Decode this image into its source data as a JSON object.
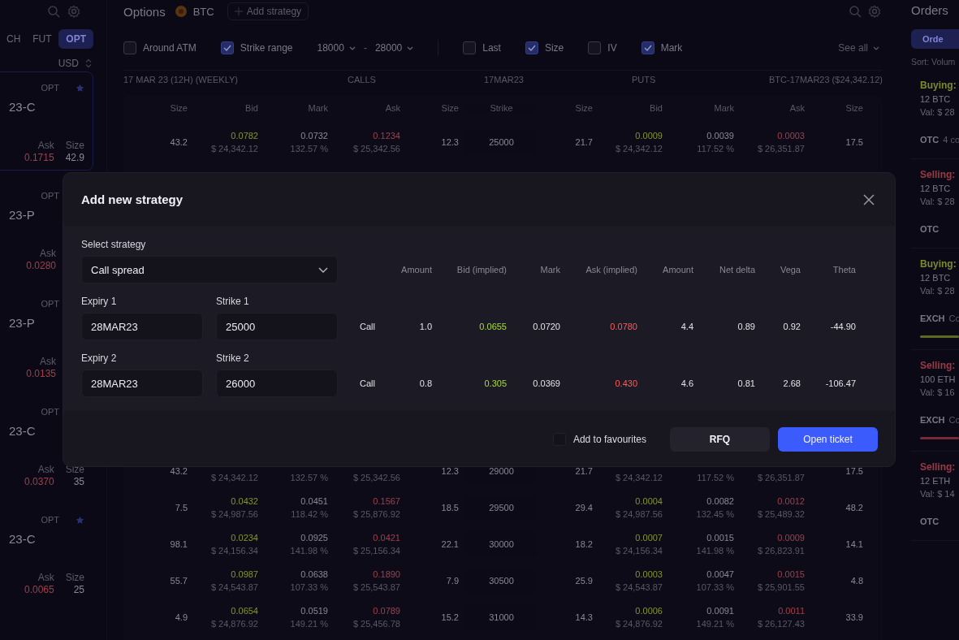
{
  "left_panel": {
    "market_tabs": [
      {
        "label": "CH",
        "selected": false
      },
      {
        "label": "FUT",
        "selected": false
      },
      {
        "label": "OPT",
        "selected": true
      }
    ],
    "currency": "USD",
    "instruments": [
      {
        "tag": "OPT",
        "starred": true,
        "selected": true,
        "name": "23-C",
        "ask_label": "Ask",
        "ask": "0.1715",
        "size_label": "Size",
        "size": "42.9"
      },
      {
        "tag": "OPT",
        "selected": false,
        "name": "23-P",
        "ask_label": "Ask",
        "ask": "0.0280"
      },
      {
        "tag": "OPT",
        "selected": false,
        "name": "23-P",
        "ask_label": "Ask",
        "ask": "0.0135"
      },
      {
        "tag": "OPT",
        "selected": false,
        "name": "23-C",
        "ask_label": "Ask",
        "ask": "0.0370",
        "size_label": "Size",
        "size": "35"
      },
      {
        "tag": "OPT",
        "starred": true,
        "selected": false,
        "name": "23-C",
        "ask_label": "Ask",
        "ask": "0.0065",
        "size_label": "Size",
        "size": "25"
      }
    ]
  },
  "main": {
    "title": "Options",
    "asset": "BTC",
    "add_strategy": "Add strategy",
    "filters": [
      {
        "label": "Around ATM",
        "checked": false
      },
      {
        "label": "Strike range",
        "checked": true
      }
    ],
    "range": {
      "from": "18000",
      "separator": "-",
      "to": "28000"
    },
    "column_toggles": [
      {
        "label": "Last",
        "checked": false
      },
      {
        "label": "Size",
        "checked": true
      },
      {
        "label": "IV",
        "checked": false
      },
      {
        "label": "Mark",
        "checked": true
      }
    ],
    "see_all": "See all",
    "section_labels": [
      "17 MAR 23 (12H) (WEEKLY)",
      "CALLS",
      "17MAR23",
      "PUTS",
      "BTC-17MAR23 ($24,342.12)"
    ],
    "columns": [
      "Size",
      "Bid",
      "Mark",
      "Ask",
      "Size",
      "Strike",
      "Size",
      "Bid",
      "Mark",
      "Ask",
      "Size"
    ],
    "rows": [
      {
        "cells": [
          "43.2",
          {
            "value": "0.0782",
            "sub": "$ 24,342.12"
          },
          {
            "value": "0.0732",
            "sub": "132.57 %"
          },
          {
            "value": "0.1234",
            "sub": "$ 25,342.56"
          },
          "12.3",
          "25000",
          "21.7",
          {
            "value": "0.0009",
            "sub": "$ 24,342.12"
          },
          {
            "value": "0.0039",
            "sub": "117.52 %"
          },
          {
            "value": "0.0003",
            "sub": "$ 26,351.87"
          },
          "17.5"
        ]
      },
      {
        "cells": [
          "43.2",
          {
            "sub": "$ 24,342.12"
          },
          {
            "sub": "132.57 %"
          },
          {
            "sub": "$ 25,342.56"
          },
          "12.3",
          "29000",
          "21.7",
          {
            "sub": "$ 24,342.12"
          },
          {
            "sub": "117.52 %"
          },
          {
            "sub": "$ 26,351.87"
          },
          "17.5"
        ]
      },
      {
        "cells": [
          "7.5",
          {
            "value": "0.0432",
            "sub": "$ 24,987.56"
          },
          {
            "value": "0.0451",
            "sub": "118.42 %"
          },
          {
            "value": "0.1567",
            "sub": "$ 25,876.92"
          },
          "18.5",
          "29500",
          "29.4",
          {
            "value": "0.0004",
            "sub": "$ 24,987.56"
          },
          {
            "value": "0.0082",
            "sub": "132.45 %"
          },
          {
            "value": "0.0012",
            "sub": "$ 25,489.32"
          },
          "48.2"
        ]
      },
      {
        "cells": [
          "98.1",
          {
            "value": "0.0234",
            "sub": "$ 24,156.34"
          },
          {
            "value": "0.0925",
            "sub": "141.98 %"
          },
          {
            "value": "0.0421",
            "sub": "$ 25,156.34"
          },
          "22.1",
          "30000",
          "18.2",
          {
            "value": "0.0007",
            "sub": "$ 24,156.34"
          },
          {
            "value": "0.0015",
            "sub": "141.98 %"
          },
          {
            "value": "0.0009",
            "sub": "$ 26,823.91"
          },
          "14.1"
        ]
      },
      {
        "cells": [
          "55.7",
          {
            "value": "0.0987",
            "sub": "$ 24,543.87"
          },
          {
            "value": "0.0638",
            "sub": "107.33 %"
          },
          {
            "value": "0.1890",
            "sub": "$ 25,543.87"
          },
          "7.9",
          "30500",
          "25.9",
          {
            "value": "0.0003",
            "sub": "$ 24,543.87"
          },
          {
            "value": "0.0047",
            "sub": "107.33 %"
          },
          {
            "value": "0.0015",
            "sub": "$ 25,901.55"
          },
          "4.8"
        ]
      },
      {
        "cells": [
          "4.9",
          {
            "value": "0.0654",
            "sub": "$ 24,876.92"
          },
          {
            "value": "0.0519",
            "sub": "149.21 %"
          },
          {
            "value": "0.0789",
            "sub": "$ 25,456.78"
          },
          "15.2",
          "31000",
          "14.3",
          {
            "value": "0.0006",
            "sub": "$ 24,876.92"
          },
          {
            "value": "0.0091",
            "sub": "149.21 %"
          },
          {
            "value": "0.0011",
            "sub": "$ 26,127.43"
          },
          "33.9"
        ]
      }
    ]
  },
  "orders": {
    "title": "Orders",
    "tab": "Orde",
    "sort": "Sort: Volum",
    "items": [
      {
        "kind": "buy",
        "side": "Buying:",
        "qty": "12 BTC",
        "value": "Val: $ 28",
        "venue": "OTC",
        "detail": "4 co",
        "progress_bar": false
      },
      {
        "kind": "sell",
        "side": "Selling:",
        "qty": "12 BTC",
        "value": "Val: $ 28",
        "venue": "OTC",
        "progress_bar": false
      },
      {
        "kind": "buy",
        "side": "Buying:",
        "qty": "12 BTC",
        "value": "Val: $ 28",
        "venue": "EXCH",
        "detail": "Co",
        "progress_bar": true
      },
      {
        "kind": "sell",
        "side": "Selling:",
        "qty": "100 ETH",
        "value": "Val: $ 16",
        "venue": "EXCH",
        "detail": "Co",
        "progress_bar": true
      },
      {
        "kind": "sell",
        "side": "Selling:",
        "qty": "12 ETH",
        "value": "Val: $ 14",
        "venue": "OTC",
        "progress_bar": false
      }
    ]
  },
  "modal": {
    "title": "Add new strategy",
    "strategy_label": "Select strategy",
    "strategy": "Call spread",
    "columns": [
      "Amount",
      "Bid (implied)",
      "Mark",
      "Ask (implied)",
      "Amount",
      "Net delta",
      "Vega",
      "Theta"
    ],
    "legs": [
      {
        "expiry_label": "Expiry 1",
        "expiry": "28MAR23",
        "strike_label": "Strike 1",
        "strike": "25000",
        "type": "Call",
        "amount": "1.0",
        "bid": "0.0655",
        "mark": "0.0720",
        "ask": "0.0780",
        "amount_2": "4.4",
        "net_delta": "0.89",
        "vega": "0.92",
        "theta": "-44.90"
      },
      {
        "expiry_label": "Expiry 2",
        "expiry": "28MAR23",
        "strike_label": "Strike 2",
        "strike": "26000",
        "type": "Call",
        "amount": "0.8",
        "bid": "0.305",
        "mark": "0.0369",
        "ask": "0.430",
        "amount_2": "4.6",
        "net_delta": "0.81",
        "vega": "2.68",
        "theta": "-106.47"
      }
    ],
    "favourite": {
      "label": "Add to favourites",
      "checked": false
    },
    "buttons": [
      {
        "label": "RFQ",
        "kind": "secondary"
      },
      {
        "label": "Open ticket",
        "kind": "primary"
      }
    ]
  }
}
